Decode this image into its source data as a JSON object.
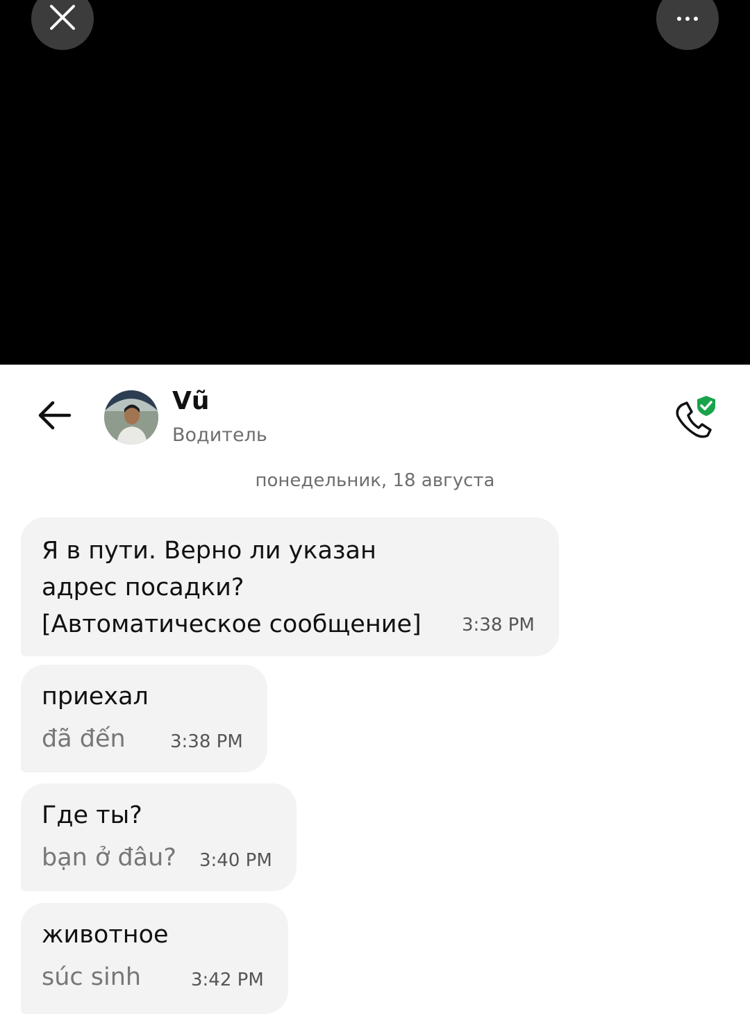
{
  "top_bar": {
    "close_icon": "close-icon",
    "more_icon": "more-horizontal-icon"
  },
  "header": {
    "back_icon": "arrow-left-icon",
    "name": "Vũ",
    "role": "Водитель",
    "call_icon": "phone-shield-check-icon",
    "verified_color": "#1aa34a"
  },
  "date_separator": "понедельник, 18 августа",
  "messages": [
    {
      "text": "Я в пути. Верно ли указан\nадрес посадки?\n[Автоматическое сообщение]",
      "translation": "",
      "time": "3:38 PM"
    },
    {
      "text": "приехал",
      "translation": "đã đến",
      "time": "3:38 PM"
    },
    {
      "text": "Где ты?",
      "translation": "bạn ở đâu?",
      "time": "3:40 PM"
    },
    {
      "text": "животное",
      "translation": "súc sinh",
      "time": "3:42 PM"
    }
  ]
}
